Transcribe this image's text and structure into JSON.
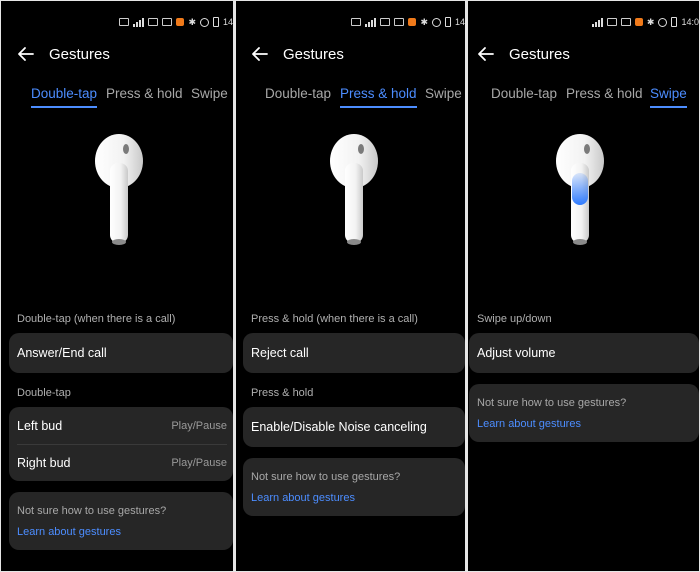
{
  "status": {
    "time_partial": "14",
    "time_partial_3": "14:0"
  },
  "panels": [
    {
      "title": "Gestures",
      "tabs": [
        "Double-tap",
        "Press & hold",
        "Swipe"
      ],
      "active_tab": 0,
      "sections": [
        {
          "label": "Double-tap (when there is a call)",
          "rows": [
            {
              "label": "Answer/End call",
              "value": ""
            }
          ]
        },
        {
          "label": "Double-tap",
          "rows": [
            {
              "label": "Left bud",
              "value": "Play/Pause"
            },
            {
              "label": "Right bud",
              "value": "Play/Pause"
            }
          ]
        }
      ],
      "help": {
        "question": "Not sure how to use gestures?",
        "link": "Learn about gestures"
      }
    },
    {
      "title": "Gestures",
      "tabs": [
        "Double-tap",
        "Press & hold",
        "Swipe"
      ],
      "active_tab": 1,
      "sections": [
        {
          "label": "Press & hold (when there is a call)",
          "rows": [
            {
              "label": "Reject call",
              "value": ""
            }
          ]
        },
        {
          "label": "Press & hold",
          "rows": [
            {
              "label": "Enable/Disable Noise canceling",
              "value": ""
            }
          ]
        }
      ],
      "help": {
        "question": "Not sure how to use gestures?",
        "link": "Learn about gestures"
      }
    },
    {
      "title": "Gestures",
      "tabs": [
        "Double-tap",
        "Press & hold",
        "Swipe"
      ],
      "active_tab": 2,
      "sections": [
        {
          "label": "Swipe up/down",
          "rows": [
            {
              "label": "Adjust volume",
              "value": ""
            }
          ]
        }
      ],
      "help": {
        "question": "Not sure how to use gestures?",
        "link": "Learn about gestures"
      }
    }
  ],
  "icons": [
    "back-arrow-icon",
    "earbud-icon"
  ],
  "colors": {
    "accent": "#4c8dff",
    "card": "#262626",
    "background": "#000000",
    "swipe_highlight": "#2f7bff"
  }
}
